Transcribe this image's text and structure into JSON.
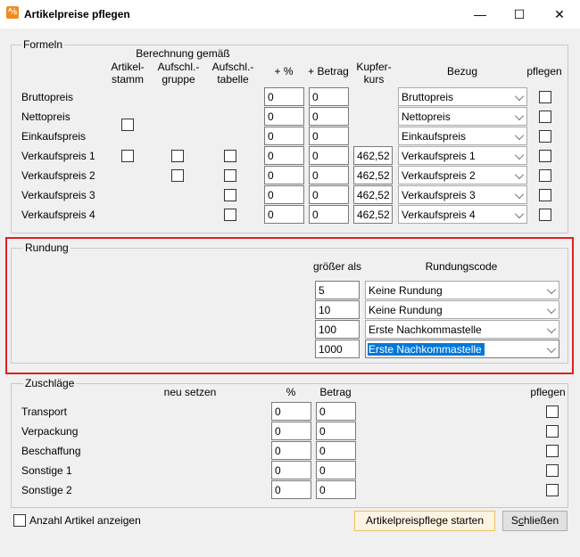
{
  "window": {
    "title": "Artikelpreise pflegen",
    "icon": "app-icon",
    "minimize": "—",
    "maximize": "☐",
    "close": "✕"
  },
  "formeln": {
    "label": "Formeln",
    "header_berechnung": "Berechnung gemäß",
    "col_artikelstamm": [
      "Artikel-",
      "stamm"
    ],
    "col_aufschl_gruppe": [
      "Aufschl.-",
      "gruppe"
    ],
    "col_aufschl_tabelle": [
      "Aufschl.-",
      "tabelle"
    ],
    "col_prozent": "+ %",
    "col_betrag": "+ Betrag",
    "col_kupferkurs": [
      "Kupfer-",
      "kurs"
    ],
    "col_bezug": "Bezug",
    "col_pflegen": "pflegen",
    "rows": [
      {
        "label": "Bruttopreis",
        "prozent": "0",
        "betrag": "0",
        "kupfer": "",
        "bezug": "Bruttopreis"
      },
      {
        "label": "Nettopreis",
        "prozent": "0",
        "betrag": "0",
        "kupfer": "",
        "bezug": "Nettopreis"
      },
      {
        "label": "Einkaufspreis",
        "prozent": "0",
        "betrag": "0",
        "kupfer": "",
        "bezug": "Einkaufspreis"
      },
      {
        "label": "Verkaufspreis 1",
        "prozent": "0",
        "betrag": "0",
        "kupfer": "462,52",
        "bezug": "Verkaufspreis 1"
      },
      {
        "label": "Verkaufspreis 2",
        "prozent": "0",
        "betrag": "0",
        "kupfer": "462,52",
        "bezug": "Verkaufspreis 2"
      },
      {
        "label": "Verkaufspreis 3",
        "prozent": "0",
        "betrag": "0",
        "kupfer": "462,52",
        "bezug": "Verkaufspreis 3"
      },
      {
        "label": "Verkaufspreis 4",
        "prozent": "0",
        "betrag": "0",
        "kupfer": "462,52",
        "bezug": "Verkaufspreis 4"
      }
    ]
  },
  "rundung": {
    "label": "Rundung",
    "col_groesser": "größer als",
    "col_code": "Rundungscode",
    "rows": [
      {
        "value": "5",
        "code": "Keine Rundung"
      },
      {
        "value": "10",
        "code": "Keine Rundung"
      },
      {
        "value": "100",
        "code": "Erste Nachkommastelle"
      },
      {
        "value": "1000",
        "code": "Erste Nachkommastelle"
      }
    ]
  },
  "zuschlaege": {
    "label": "Zuschläge",
    "col_neu": "neu setzen",
    "col_prozent": "%",
    "col_betrag": "Betrag",
    "col_pflegen": "pflegen",
    "rows": [
      {
        "label": "Transport",
        "prozent": "0",
        "betrag": "0"
      },
      {
        "label": "Verpackung",
        "prozent": "0",
        "betrag": "0"
      },
      {
        "label": "Beschaffung",
        "prozent": "0",
        "betrag": "0"
      },
      {
        "label": "Sonstige 1",
        "prozent": "0",
        "betrag": "0"
      },
      {
        "label": "Sonstige 2",
        "prozent": "0",
        "betrag": "0"
      }
    ]
  },
  "footer": {
    "anzahl_label": "Anzahl Artikel anzeigen",
    "start_button": "Artikelpreispflege starten",
    "close_button_prefix": "S",
    "close_button_mnemonic": "c",
    "close_button_suffix": "hließen"
  },
  "colors": {
    "accent": "#0078d7",
    "highlight_border": "#e02020",
    "icon": "#f08a1c"
  }
}
